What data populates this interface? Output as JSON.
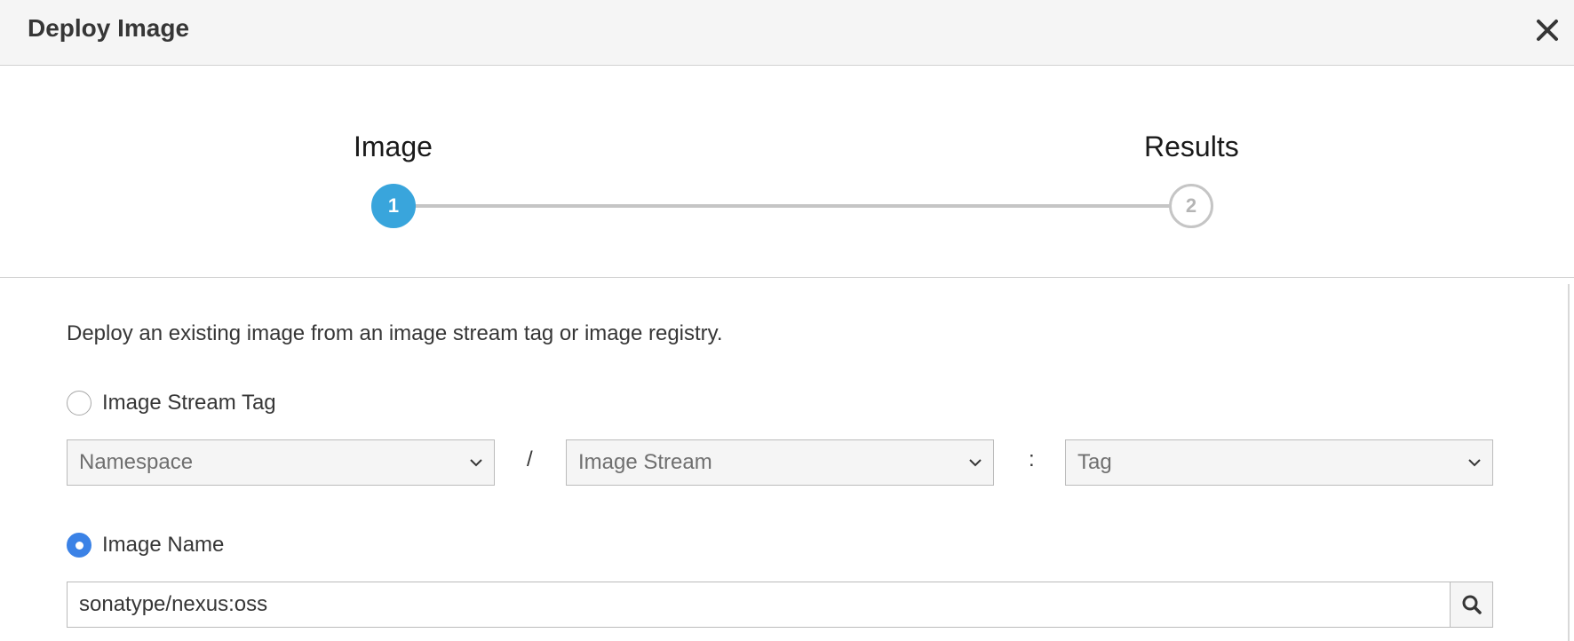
{
  "header": {
    "title": "Deploy Image"
  },
  "wizard": {
    "steps": [
      {
        "label": "Image",
        "number": "1",
        "state": "active"
      },
      {
        "label": "Results",
        "number": "2",
        "state": "inactive"
      }
    ]
  },
  "form": {
    "intro": "Deploy an existing image from an image stream tag or image registry.",
    "image_stream_tag": {
      "label": "Image Stream Tag",
      "selected": false,
      "namespace_placeholder": "Namespace",
      "image_stream_placeholder": "Image Stream",
      "tag_placeholder": "Tag",
      "slash": "/",
      "colon": ":"
    },
    "image_name": {
      "label": "Image Name",
      "selected": true,
      "value": "sonatype/nexus:oss"
    }
  },
  "colors": {
    "accent": "#39a5dc",
    "radio_checked": "#3b82e6",
    "border": "#bbbbbb",
    "header_bg": "#f5f5f5"
  },
  "icons": {
    "close": "close-icon",
    "chevron": "chevron-down-icon",
    "search": "search-icon"
  }
}
